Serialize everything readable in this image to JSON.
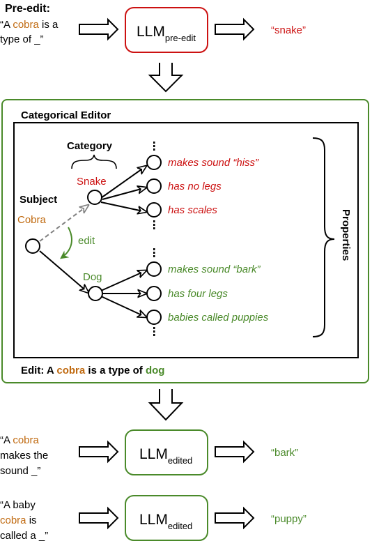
{
  "colors": {
    "red": "#cc1111",
    "green": "#4a8a2a",
    "orange": "#c06a10",
    "gray": "#808080",
    "black": "#000000"
  },
  "pre_edit": {
    "heading": "Pre-edit:",
    "prompt_line1_a": "“A ",
    "prompt_line1_subject": "cobra",
    "prompt_line1_b": " is a",
    "prompt_line2": "type of _”",
    "model_base": "LLM",
    "model_sub": "pre-edit",
    "output": "“snake”"
  },
  "editor": {
    "title": "Categorical Editor",
    "category_label": "Category",
    "subject_label": "Subject",
    "subject_name": "Cobra",
    "edit_label": "edit",
    "old_category": "Snake",
    "new_category": "Dog",
    "snake_properties": [
      "makes sound “hiss”",
      "has no legs",
      "has scales"
    ],
    "dog_properties": [
      "makes sound “bark”",
      "has four legs",
      "babies called puppies"
    ],
    "properties_label": "Properties",
    "edit_caption": {
      "prefix": "Edit: A ",
      "subject": "cobra",
      "middle": " is a type of ",
      "target": "dog"
    }
  },
  "post_edit": [
    {
      "prompt_lines": [
        {
          "a": "“A ",
          "subj": "cobra",
          "b": ""
        },
        {
          "a": "makes the",
          "subj": "",
          "b": ""
        },
        {
          "a": "sound _”",
          "subj": "",
          "b": ""
        }
      ],
      "model_base": "LLM",
      "model_sub": "edited",
      "output": "“bark”"
    },
    {
      "prompt_lines": [
        {
          "a": "“A baby",
          "subj": "",
          "b": ""
        },
        {
          "a": "",
          "subj": "cobra",
          "b": " is"
        },
        {
          "a": "called a _”",
          "subj": "",
          "b": ""
        }
      ],
      "model_base": "LLM",
      "model_sub": "edited",
      "output": "“puppy”"
    }
  ]
}
